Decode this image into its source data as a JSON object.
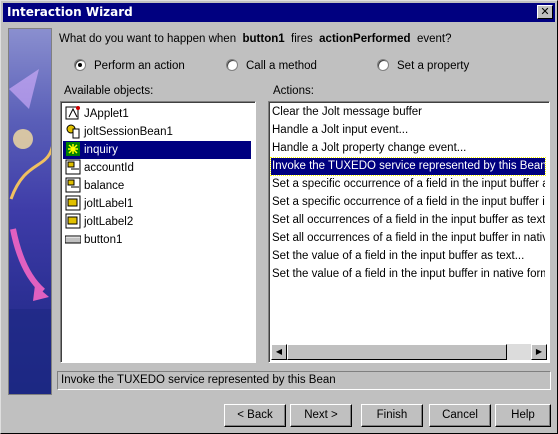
{
  "window": {
    "title": "Interaction Wizard",
    "close_glyph": "✕"
  },
  "question": {
    "prefix": "What do you want to happen when",
    "source": "button1",
    "middle": "fires",
    "event": "actionPerformed",
    "suffix": "event?"
  },
  "radios": [
    {
      "label": "Perform an action",
      "checked": true
    },
    {
      "label": "Call a method",
      "checked": false
    },
    {
      "label": "Set a property",
      "checked": false
    }
  ],
  "objects": {
    "label": "Available objects:",
    "items": [
      {
        "label": "JApplet1",
        "icon": "applet-icon"
      },
      {
        "label": "joltSessionBean1",
        "icon": "bean-icon"
      },
      {
        "label": "inquiry",
        "icon": "service-icon",
        "selected": true
      },
      {
        "label": "accountId",
        "icon": "field-icon"
      },
      {
        "label": "balance",
        "icon": "field-icon"
      },
      {
        "label": "joltLabel1",
        "icon": "label-icon"
      },
      {
        "label": "joltLabel2",
        "icon": "label-icon"
      },
      {
        "label": "button1",
        "icon": "button-icon"
      }
    ]
  },
  "actions": {
    "label": "Actions:",
    "items": [
      {
        "label": "Clear the Jolt message buffer"
      },
      {
        "label": "Handle a Jolt input event..."
      },
      {
        "label": "Handle a Jolt property change event..."
      },
      {
        "label": "Invoke the TUXEDO service represented by this Bean",
        "selected": true
      },
      {
        "label": "Set a specific occurrence of a field in the input buffer as text..."
      },
      {
        "label": "Set a specific occurrence of a field in the input buffer in native format..."
      },
      {
        "label": "Set all occurrences of a field in the input buffer as text..."
      },
      {
        "label": "Set all occurrences of a field in the input buffer in native format..."
      },
      {
        "label": "Set the value of a field in the input buffer as text..."
      },
      {
        "label": "Set the value of a field in the input buffer in native format..."
      }
    ]
  },
  "status_text": "Invoke the TUXEDO service represented by this Bean",
  "buttons": {
    "back": "< Back",
    "next": "Next >",
    "finish": "Finish",
    "cancel": "Cancel",
    "help": "Help"
  },
  "colors": {
    "selection": "#000080",
    "titlebar": "#000080",
    "face": "#c0c0c0"
  }
}
